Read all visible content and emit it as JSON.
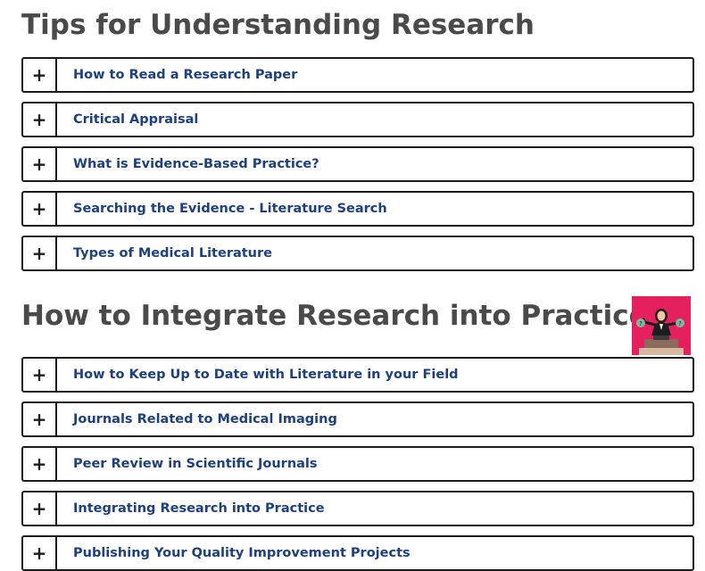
{
  "sections": [
    {
      "title": "Tips for Understanding Research",
      "items": [
        {
          "label": "How to Read a Research Paper"
        },
        {
          "label": "Critical Appraisal"
        },
        {
          "label": "What is Evidence-Based Practice?"
        },
        {
          "label": "Searching the Evidence - Literature Search"
        },
        {
          "label": "Types of Medical Literature"
        }
      ]
    },
    {
      "title": "How to Integrate Research into Practice",
      "items": [
        {
          "label": "How to Keep Up to Date with Literature in your Field"
        },
        {
          "label": "Journals Related to Medical Imaging"
        },
        {
          "label": "Peer Review in Scientific Journals"
        },
        {
          "label": "Integrating Research into Practice"
        },
        {
          "label": "Publishing Your Quality Improvement Projects"
        }
      ]
    }
  ],
  "toggle_symbol": "+",
  "icons": {
    "expand": "plus-icon",
    "illustration": "person-with-question-marks-illustration"
  },
  "colors": {
    "heading": "#4a4a4a",
    "link": "#1d4080",
    "border": "#1c1c1c",
    "illustration_bg": "#e4205f"
  }
}
